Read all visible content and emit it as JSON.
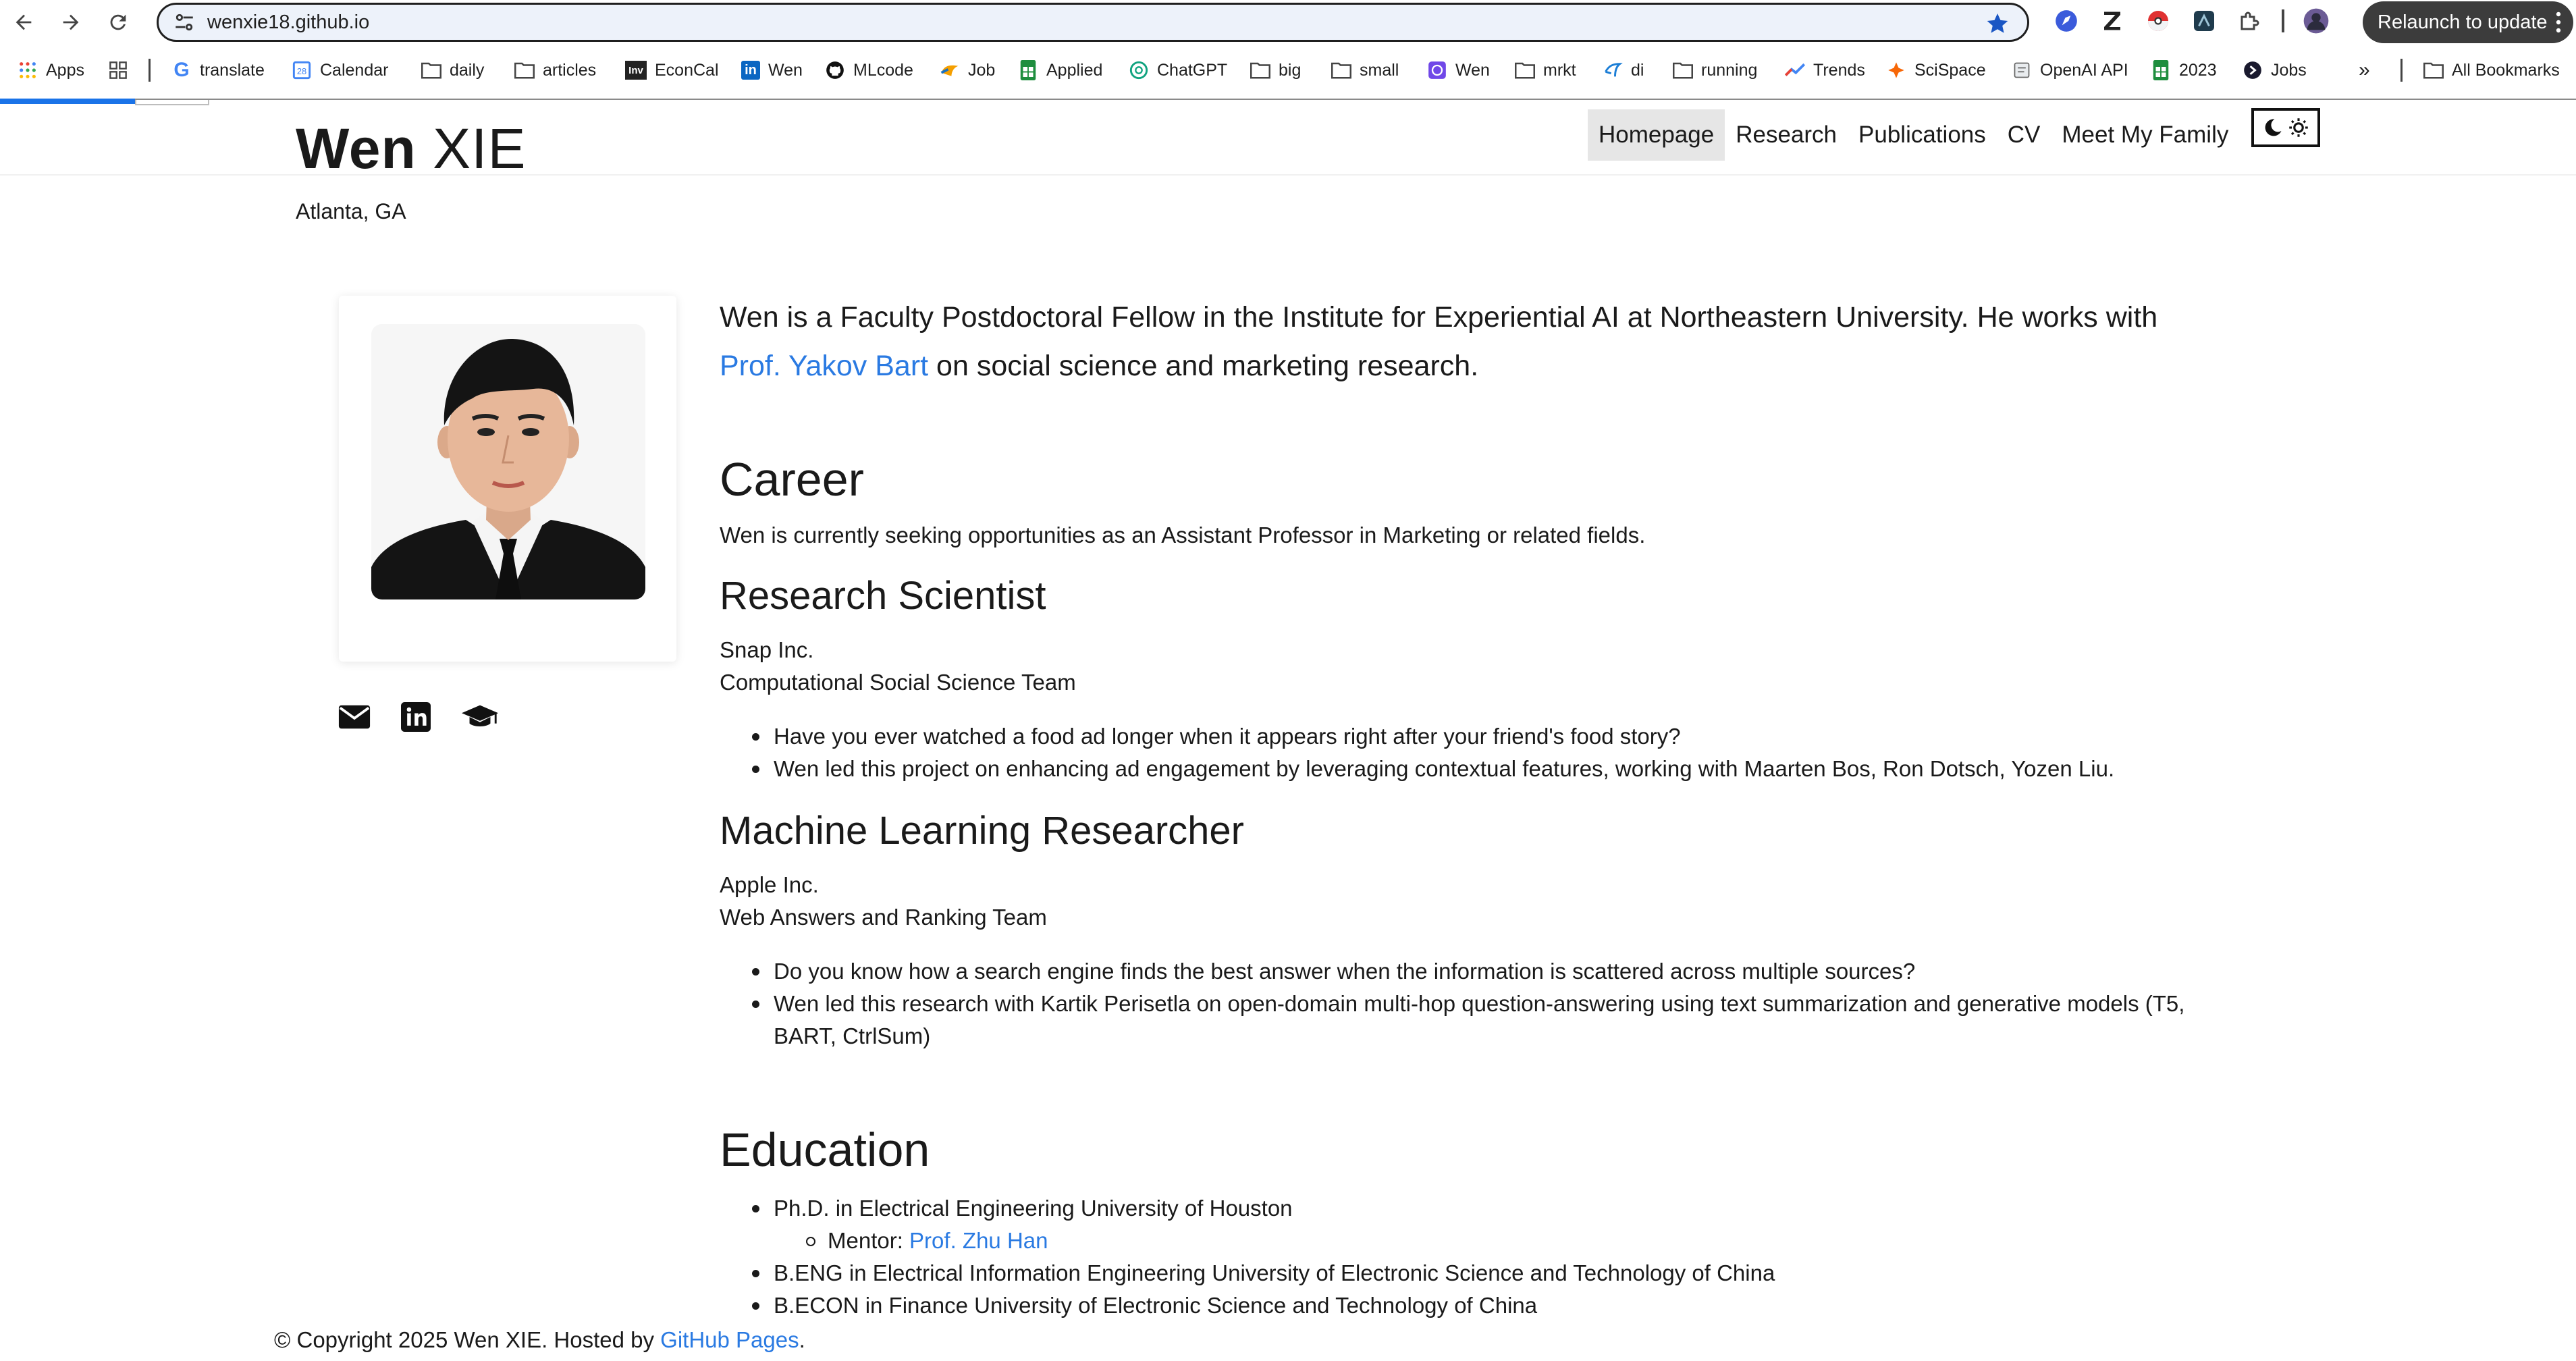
{
  "browser": {
    "url": "wenxie18.github.io",
    "relaunch_label": "Relaunch to update",
    "bookmarks": [
      {
        "label": "Apps",
        "icon": "apps-grid-icon"
      },
      {
        "label": "",
        "icon": "tab-groups-icon"
      },
      {
        "label": "translate",
        "icon": "google-icon"
      },
      {
        "label": "Calendar",
        "icon": "calendar-icon"
      },
      {
        "label": "daily",
        "icon": "folder-icon"
      },
      {
        "label": "articles",
        "icon": "folder-icon"
      },
      {
        "label": "EconCal",
        "icon": "investing-icon"
      },
      {
        "label": "Wen",
        "icon": "linkedin-icon"
      },
      {
        "label": "MLcode",
        "icon": "github-icon"
      },
      {
        "label": "Job",
        "icon": "job-icon"
      },
      {
        "label": "Applied",
        "icon": "sheets-icon"
      },
      {
        "label": "ChatGPT",
        "icon": "chatgpt-icon"
      },
      {
        "label": "big",
        "icon": "folder-icon"
      },
      {
        "label": "small",
        "icon": "folder-icon"
      },
      {
        "label": "Wen",
        "icon": "web-icon"
      },
      {
        "label": "mrkt",
        "icon": "folder-icon"
      },
      {
        "label": "di",
        "icon": "di-icon"
      },
      {
        "label": "running",
        "icon": "folder-icon"
      },
      {
        "label": "Trends",
        "icon": "trends-icon"
      },
      {
        "label": "SciSpace",
        "icon": "scispace-icon"
      },
      {
        "label": "OpenAI API",
        "icon": "openai-icon"
      },
      {
        "label": "2023",
        "icon": "sheets-icon"
      },
      {
        "label": "Jobs",
        "icon": "jobs-icon"
      },
      {
        "label": "All Bookmarks",
        "icon": "folder-icon"
      }
    ]
  },
  "site": {
    "first_name": "Wen",
    "last_name": "XIE",
    "location": "Atlanta, GA",
    "nav": [
      "Homepage",
      "Research",
      "Publications",
      "CV",
      "Meet My Family"
    ],
    "active_nav": "Homepage"
  },
  "intro": {
    "text_before": "Wen is a Faculty Postdoctoral Fellow in the Institute for Experiential AI at Northeastern University. He works with ",
    "link": "Prof. Yakov Bart",
    "text_after": " on social science and marketing research."
  },
  "career": {
    "heading": "Career",
    "summary": "Wen is currently seeking opportunities as an Assistant Professor in Marketing or related fields.",
    "jobs": [
      {
        "title": "Research Scientist",
        "company": "Snap Inc.",
        "team": "Computational Social Science Team",
        "bullets": [
          "Have you ever watched a food ad longer when it appears right after your friend's food story?",
          "Wen led this project on enhancing ad engagement by leveraging contextual features, working with Maarten Bos, Ron Dotsch, Yozen Liu."
        ]
      },
      {
        "title": "Machine Learning Researcher",
        "company": "Apple Inc.",
        "team": "Web Answers and Ranking Team",
        "bullets": [
          "Do you know how a search engine finds the best answer when the information is scattered across multiple sources?",
          "Wen led this research with Kartik Perisetla on open-domain multi-hop question-answering using text summarization and generative models (T5, BART, CtrlSum)"
        ]
      }
    ]
  },
  "education": {
    "heading": "Education",
    "phd": "Ph.D. in Electrical Engineering University of Houston",
    "mentor_label": "Mentor: ",
    "mentor_link": "Prof. Zhu Han",
    "beng": "B.ENG in Electrical Information Engineering University of Electronic Science and Technology of China",
    "becon": "B.ECON in Finance University of Electronic Science and Technology of China"
  },
  "footer": {
    "text": "© Copyright 2025 Wen XIE. Hosted by ",
    "link": "GitHub Pages",
    "end": "."
  },
  "colors": {
    "link": "#2a7ae2",
    "accent": "#1a73e8"
  }
}
